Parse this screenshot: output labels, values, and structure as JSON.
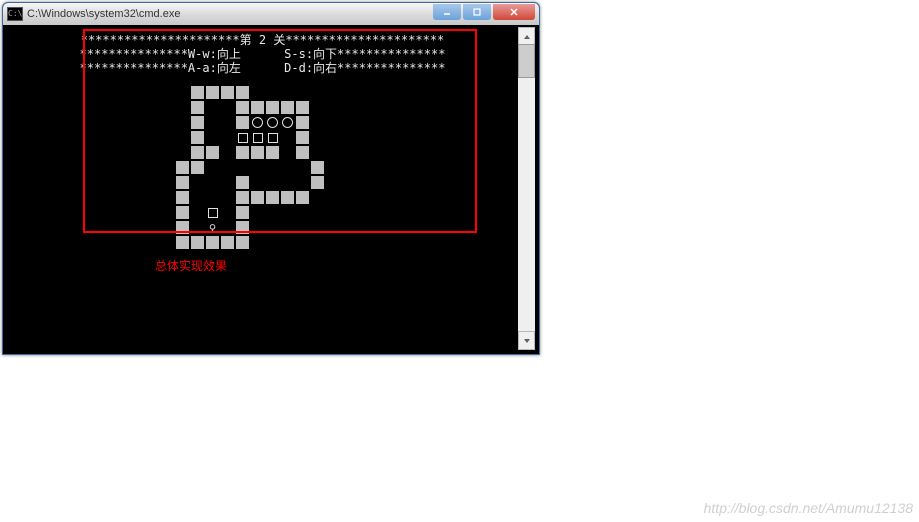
{
  "window": {
    "title": "C:\\Windows\\system32\\cmd.exe",
    "icon_label": "C:\\"
  },
  "header": {
    "line1": "**********************第 2 关**********************",
    "line2": "***************W-w:向上      S-s:向下***************",
    "line3": "***************A-a:向左      D-d:向右***************"
  },
  "game": {
    "level": 2,
    "controls": {
      "up": "W-w:向上",
      "down": "S-s:向下",
      "left": "A-a:向左",
      "right": "D-d:向右"
    },
    "legend": {
      "W": "wall",
      "G": "goal",
      "B": "box",
      "P": "player",
      ".": "empty"
    },
    "map": [
      ".WWWW....",
      ".W..WWWWW",
      ".W..WGGGW",
      ".W..BBB.W",
      ".WW.WWW.W",
      "WW.......W",
      "W...W....W",
      "W...WWWWW",
      "W.B.W....",
      "W.P.W....",
      "WWWWW...."
    ]
  },
  "caption": "总体实现效果",
  "watermark": "http://blog.csdn.net/Amumu12138"
}
